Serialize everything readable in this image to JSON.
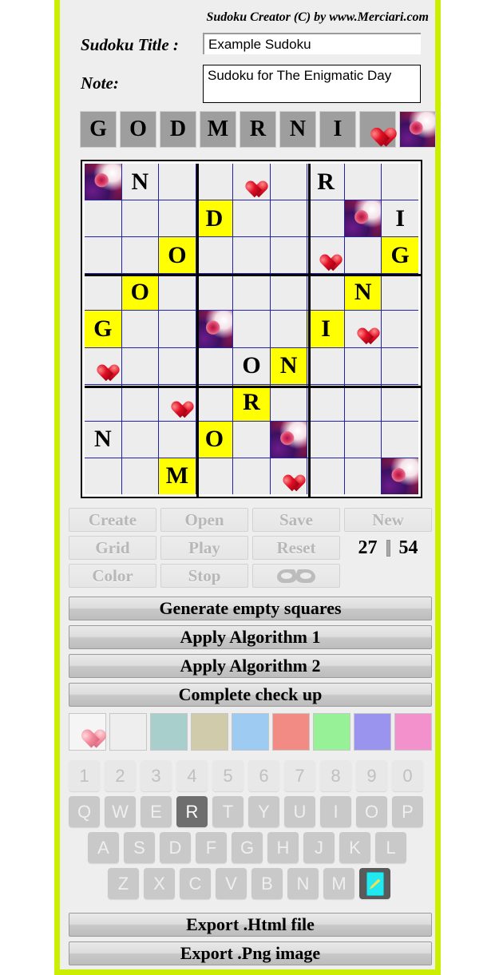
{
  "app": {
    "title": "Sudoku Creator (C) by www.Merciari.com",
    "border_color": "#ccee00",
    "background": "#eeeeee"
  },
  "form": {
    "title_label": "Sudoku Title :",
    "title_value": "Example Sudoku",
    "title_placeholder": "",
    "note_label": "Note:",
    "note_value": "Sudoku for The Enigmatic Day",
    "note_placeholder": ""
  },
  "palette": [
    {
      "type": "letter",
      "label": "G"
    },
    {
      "type": "letter",
      "label": "O"
    },
    {
      "type": "letter",
      "label": "D"
    },
    {
      "type": "letter",
      "label": "M"
    },
    {
      "type": "letter",
      "label": "R"
    },
    {
      "type": "letter",
      "label": "N"
    },
    {
      "type": "letter",
      "label": "I"
    },
    {
      "type": "icon",
      "label": "heart-icon"
    },
    {
      "type": "icon",
      "label": "rose-image"
    }
  ],
  "grid": {
    "size": 9,
    "highlight_color": "#ffff00",
    "cell_background": "#ededed",
    "line_color": "#2222aa",
    "block_line_color": "#000000",
    "rows": [
      [
        {
          "v": "rose",
          "hl": false
        },
        {
          "v": "N",
          "hl": false
        },
        {
          "v": "",
          "hl": false
        },
        {
          "v": "",
          "hl": false
        },
        {
          "v": "heart",
          "hl": false
        },
        {
          "v": "",
          "hl": false
        },
        {
          "v": "R",
          "hl": false
        },
        {
          "v": "",
          "hl": false
        },
        {
          "v": "",
          "hl": false
        }
      ],
      [
        {
          "v": "",
          "hl": false
        },
        {
          "v": "",
          "hl": false
        },
        {
          "v": "",
          "hl": false
        },
        {
          "v": "D",
          "hl": true
        },
        {
          "v": "",
          "hl": false
        },
        {
          "v": "",
          "hl": false
        },
        {
          "v": "",
          "hl": false
        },
        {
          "v": "rose",
          "hl": false
        },
        {
          "v": "I",
          "hl": false
        }
      ],
      [
        {
          "v": "",
          "hl": false
        },
        {
          "v": "",
          "hl": false
        },
        {
          "v": "O",
          "hl": true
        },
        {
          "v": "",
          "hl": false
        },
        {
          "v": "",
          "hl": false
        },
        {
          "v": "",
          "hl": false
        },
        {
          "v": "heart",
          "hl": false
        },
        {
          "v": "",
          "hl": false
        },
        {
          "v": "G",
          "hl": true
        }
      ],
      [
        {
          "v": "",
          "hl": false
        },
        {
          "v": "O",
          "hl": true
        },
        {
          "v": "",
          "hl": false
        },
        {
          "v": "",
          "hl": false
        },
        {
          "v": "",
          "hl": false
        },
        {
          "v": "",
          "hl": false
        },
        {
          "v": "",
          "hl": false
        },
        {
          "v": "N",
          "hl": true
        },
        {
          "v": "",
          "hl": false
        }
      ],
      [
        {
          "v": "G",
          "hl": true
        },
        {
          "v": "",
          "hl": false
        },
        {
          "v": "",
          "hl": false
        },
        {
          "v": "rose",
          "hl": false
        },
        {
          "v": "",
          "hl": false
        },
        {
          "v": "",
          "hl": false
        },
        {
          "v": "I",
          "hl": true
        },
        {
          "v": "heart",
          "hl": false
        },
        {
          "v": "",
          "hl": false
        }
      ],
      [
        {
          "v": "heart",
          "hl": false
        },
        {
          "v": "",
          "hl": false
        },
        {
          "v": "",
          "hl": false
        },
        {
          "v": "",
          "hl": false
        },
        {
          "v": "O",
          "hl": false
        },
        {
          "v": "N",
          "hl": true
        },
        {
          "v": "",
          "hl": false
        },
        {
          "v": "",
          "hl": false
        },
        {
          "v": "",
          "hl": false
        }
      ],
      [
        {
          "v": "",
          "hl": false
        },
        {
          "v": "",
          "hl": false
        },
        {
          "v": "heart",
          "hl": false
        },
        {
          "v": "",
          "hl": false
        },
        {
          "v": "R",
          "hl": true
        },
        {
          "v": "",
          "hl": false
        },
        {
          "v": "",
          "hl": false
        },
        {
          "v": "",
          "hl": false
        },
        {
          "v": "",
          "hl": false
        }
      ],
      [
        {
          "v": "N",
          "hl": false
        },
        {
          "v": "",
          "hl": false
        },
        {
          "v": "",
          "hl": false
        },
        {
          "v": "O",
          "hl": true
        },
        {
          "v": "",
          "hl": false
        },
        {
          "v": "rose",
          "hl": false
        },
        {
          "v": "",
          "hl": false
        },
        {
          "v": "",
          "hl": false
        },
        {
          "v": "",
          "hl": false
        }
      ],
      [
        {
          "v": "",
          "hl": false
        },
        {
          "v": "",
          "hl": false
        },
        {
          "v": "M",
          "hl": true
        },
        {
          "v": "",
          "hl": false
        },
        {
          "v": "",
          "hl": false
        },
        {
          "v": "heart",
          "hl": false
        },
        {
          "v": "",
          "hl": false
        },
        {
          "v": "",
          "hl": false
        },
        {
          "v": "rose",
          "hl": false
        }
      ]
    ]
  },
  "controls": {
    "create": "Create",
    "open": "Open",
    "save": "Save",
    "new": "New",
    "grid": "Grid",
    "play": "Play",
    "reset": "Reset",
    "color": "Color",
    "stop": "Stop",
    "mask": "mask-icon",
    "counter_left": "27",
    "counter_right": "54"
  },
  "actions": {
    "generate": "Generate empty squares",
    "algorithm1": "Apply Algorithm 1",
    "algorithm2": "Apply Algorithm 2",
    "checkup": "Complete check up",
    "export_html": "Export .Html file",
    "export_png": "Export .Png image"
  },
  "swatches": [
    {
      "name": "heart-swatch",
      "color": "#f5f5f5",
      "kind": "heart"
    },
    {
      "name": "rose-swatch",
      "color": "#8a5a80",
      "kind": "rose"
    },
    {
      "name": "teal-swatch",
      "color": "#a8cfcb",
      "kind": "solid"
    },
    {
      "name": "khaki-swatch",
      "color": "#cfcbab",
      "kind": "solid"
    },
    {
      "name": "lightblue-swatch",
      "color": "#9ecbf2",
      "kind": "solid"
    },
    {
      "name": "salmon-swatch",
      "color": "#f18b84",
      "kind": "solid"
    },
    {
      "name": "lightgreen-swatch",
      "color": "#97f297",
      "kind": "solid"
    },
    {
      "name": "periwinkle-swatch",
      "color": "#9b94ef",
      "kind": "solid"
    },
    {
      "name": "pink-swatch",
      "color": "#f291cb",
      "kind": "solid"
    }
  ],
  "keyboard": {
    "selected_key": "R",
    "rows": [
      {
        "type": "num",
        "keys": [
          "1",
          "2",
          "3",
          "4",
          "5",
          "6",
          "7",
          "8",
          "9",
          "0"
        ]
      },
      {
        "type": "ltr",
        "keys": [
          "Q",
          "W",
          "E",
          "R",
          "T",
          "Y",
          "U",
          "I",
          "O",
          "P"
        ]
      },
      {
        "type": "ltr",
        "keys": [
          "A",
          "S",
          "D",
          "F",
          "G",
          "H",
          "J",
          "K",
          "L"
        ]
      },
      {
        "type": "ltr",
        "keys": [
          "Z",
          "X",
          "C",
          "V",
          "B",
          "N",
          "M"
        ]
      }
    ],
    "eraser_label": "eraser-key"
  }
}
